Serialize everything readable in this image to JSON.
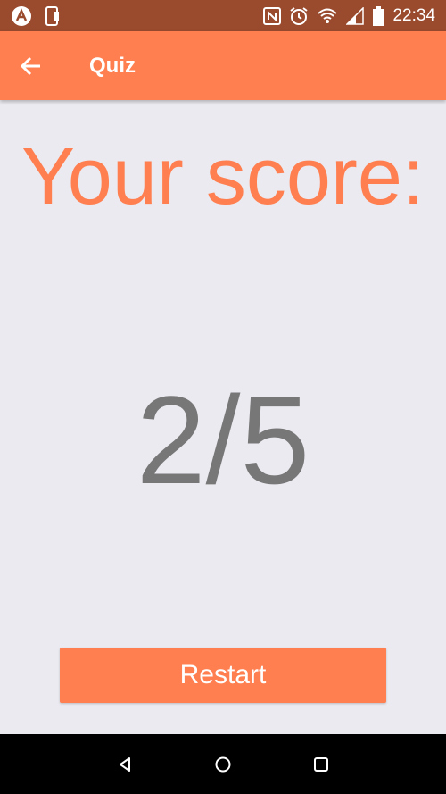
{
  "status_bar": {
    "time": "22:34",
    "icons": [
      "app-logo-icon",
      "phone-icon",
      "nfc-icon",
      "alarm-icon",
      "wifi-icon",
      "signal-icon",
      "battery-icon"
    ]
  },
  "app_bar": {
    "title": "Quiz",
    "back_icon": "arrow-back-icon"
  },
  "main": {
    "heading": "Your score:",
    "score": "2/5",
    "restart_label": "Restart"
  },
  "nav_bar": {
    "icons": [
      "back-triangle-icon",
      "home-circle-icon",
      "recents-square-icon"
    ]
  },
  "colors": {
    "accent": "#ff7f50",
    "status_bar": "#9a4a2d",
    "background": "#ebeaf0",
    "score_text": "#777777"
  }
}
